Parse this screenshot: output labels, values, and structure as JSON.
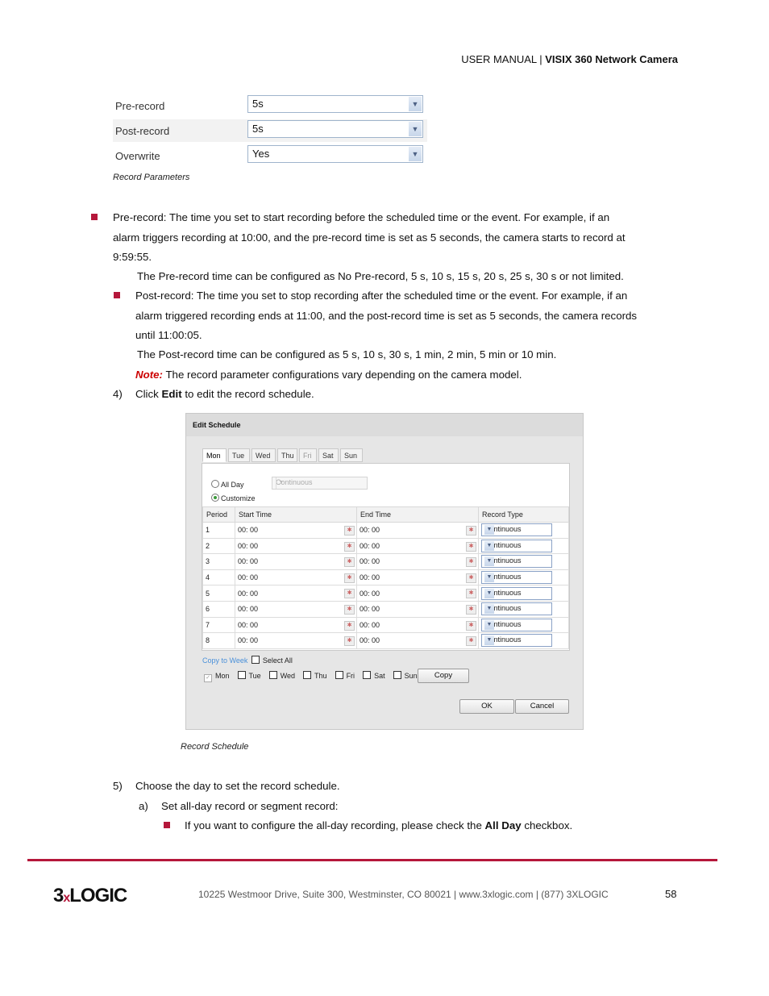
{
  "header": {
    "prefix": "USER MANUAL | ",
    "product": "VISIX 360 Network Camera"
  },
  "record_params": {
    "rows": [
      {
        "label": "Pre-record",
        "value": "5s"
      },
      {
        "label": "Post-record",
        "value": "5s"
      },
      {
        "label": "Overwrite",
        "value": "Yes"
      }
    ],
    "caption": "Record Parameters"
  },
  "text": {
    "pre_record_1": "Pre-record: The time you set to start recording before the scheduled time or the event. For example, if an",
    "pre_record_2": "alarm triggers recording at 10:00, and the pre-record time is set as 5 seconds, the camera starts to record at",
    "pre_record_3": "9:59:55.",
    "pre_record_options": "The Pre-record time can be configured as No Pre-record, 5 s, 10 s, 15 s, 20 s, 25 s, 30 s or not limited.",
    "post_record_1": "Post-record: The time you set to stop recording after the scheduled time or the event. For example, if an",
    "post_record_2": "alarm triggered recording ends at 11:00, and the post-record time is set as 5 seconds, the camera records",
    "post_record_3": "until 11:00:05.",
    "post_record_options": "The Post-record time can be configured as 5 s, 10 s, 30 s, 1 min, 2 min, 5 min or 10 min.",
    "note_label": "Note:",
    "note_text": " The record parameter configurations vary depending on the camera model.",
    "step4_num": "4)",
    "step4_pre": "Click ",
    "step4_bold": "Edit",
    "step4_post": " to edit the record schedule.",
    "step5_num": "5)",
    "step5": "Choose the day to set the record schedule.",
    "step5a_num": "a)",
    "step5a": "Set all-day record or segment record:",
    "allday_pre": "If you want to configure the all-day recording, please check the ",
    "allday_bold": "All Day",
    "allday_post": " checkbox."
  },
  "dialog": {
    "title": "Edit Schedule",
    "tabs": [
      "Mon",
      "Tue",
      "Wed",
      "Thu",
      "Fri",
      "Sat",
      "Sun"
    ],
    "active_tab": "Mon",
    "all_day_label": "All Day",
    "all_day_type": "Continuous",
    "customize_label": "Customize",
    "selected_mode": "Customize",
    "columns": [
      "Period",
      "Start Time",
      "End Time",
      "Record Type"
    ],
    "rows": [
      {
        "period": "1",
        "start": "00: 00",
        "end": "00: 00",
        "type": "Continuous"
      },
      {
        "period": "2",
        "start": "00: 00",
        "end": "00: 00",
        "type": "Continuous"
      },
      {
        "period": "3",
        "start": "00: 00",
        "end": "00: 00",
        "type": "Continuous"
      },
      {
        "period": "4",
        "start": "00: 00",
        "end": "00: 00",
        "type": "Continuous"
      },
      {
        "period": "5",
        "start": "00: 00",
        "end": "00: 00",
        "type": "Continuous"
      },
      {
        "period": "6",
        "start": "00: 00",
        "end": "00: 00",
        "type": "Continuous"
      },
      {
        "period": "7",
        "start": "00: 00",
        "end": "00: 00",
        "type": "Continuous"
      },
      {
        "period": "8",
        "start": "00: 00",
        "end": "00: 00",
        "type": "Continuous"
      }
    ],
    "copy_to_week": "Copy to Week",
    "select_all": "Select All",
    "copy_days": [
      "Mon",
      "Tue",
      "Wed",
      "Thu",
      "Fri",
      "Sat",
      "Sun"
    ],
    "copy_button": "Copy",
    "ok_button": "OK",
    "cancel_button": "Cancel",
    "caption": "Record Schedule"
  },
  "footer": {
    "logo_a": "3",
    "logo_x": "x",
    "logo_b": "LOGIC",
    "address": "10225 Westmoor Drive, Suite 300, Westminster, CO 80021 | www.3xlogic.com | (877) 3XLOGIC",
    "page": "58"
  },
  "colors": {
    "accent": "#b5173b",
    "note": "#cc0000",
    "link": "#4a90d9"
  }
}
